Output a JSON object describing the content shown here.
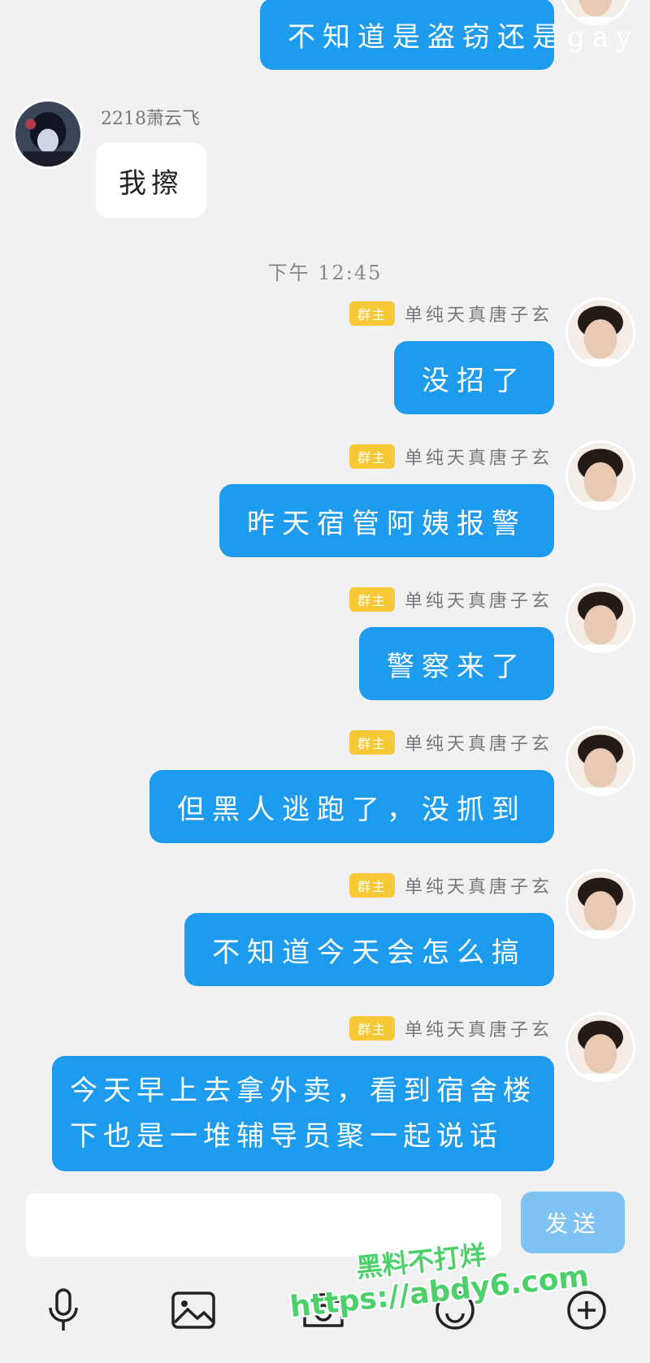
{
  "chat": {
    "timestamp": "下午 12:45",
    "messages": [
      {
        "side": "out",
        "text": "不知道是盗窃还是gay"
      },
      {
        "side": "in",
        "sender": "2218萧云飞",
        "text": "我擦"
      },
      {
        "side": "out",
        "sender": "单纯天真唐子玄",
        "badge": "群主",
        "text": "没招了"
      },
      {
        "side": "out",
        "sender": "单纯天真唐子玄",
        "badge": "群主",
        "text": "昨天宿管阿姨报警"
      },
      {
        "side": "out",
        "sender": "单纯天真唐子玄",
        "badge": "群主",
        "text": "警察来了"
      },
      {
        "side": "out",
        "sender": "单纯天真唐子玄",
        "badge": "群主",
        "text": "但黑人逃跑了，没抓到"
      },
      {
        "side": "out",
        "sender": "单纯天真唐子玄",
        "badge": "群主",
        "text": "不知道今天会怎么搞"
      },
      {
        "side": "out",
        "sender": "单纯天真唐子玄",
        "badge": "群主",
        "text_line1": "今天早上去拿外卖，看到宿舍楼",
        "text_line2": "下也是一堆辅导员聚一起说话"
      }
    ]
  },
  "composer": {
    "input_value": "",
    "send_label": "发送",
    "toolbar": [
      "microphone-icon",
      "image-icon",
      "camera-icon",
      "emoji-icon",
      "plus-icon"
    ]
  },
  "watermark": {
    "line1": "黑料不打烊",
    "line2": "https://abdy6.com"
  },
  "colors": {
    "outgoing_bubble": "#1c9bef",
    "incoming_bubble": "#ffffff",
    "owner_badge": "#f7c836",
    "send_button": "#7fc3f5",
    "background": "#f1f1f3"
  }
}
